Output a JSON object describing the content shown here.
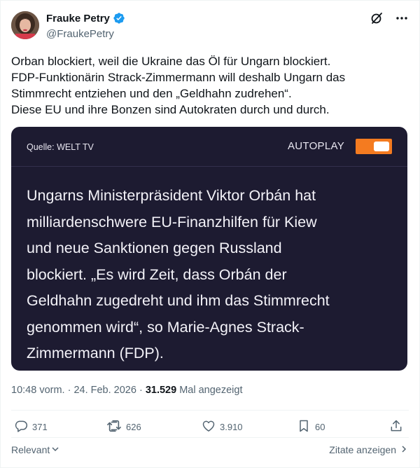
{
  "author": {
    "display_name": "Frauke Petry",
    "handle": "@FraukePetry",
    "verified": true
  },
  "tweet": {
    "lines": [
      "Orban blockiert, weil die Ukraine das Öl für Ungarn blockiert.",
      "FDP-Funktionärin Strack-Zimmermann will deshalb Ungarn das",
      "Stimmrecht entziehen und den „Geldhahn zudrehen“.",
      "Diese EU und ihre Bonzen sind Autokraten durch und durch."
    ]
  },
  "media": {
    "source": "Quelle: WELT TV",
    "autoplay_label": "AUTOPLAY",
    "autoplay_on": true,
    "quote_lines": [
      "Ungarns Ministerpräsident Viktor Orbán hat",
      "milliardenschwere EU-Finanzhilfen für Kiew",
      "und neue Sanktionen gegen Russland",
      "blockiert. „Es wird Zeit, dass Orbán der",
      "Geldhahn zugedreht und ihm das Stimmrecht",
      "genommen wird“, so Marie-Agnes Strack-",
      "Zimmermann (FDP)."
    ]
  },
  "meta": {
    "time_date": "10:48 vorm. · 24. Feb. 2026 · ",
    "views_count": "31.529",
    "views_label": " Mal angezeigt"
  },
  "actions": {
    "replies": "371",
    "reposts": "626",
    "likes": "3.910",
    "bookmarks": "60"
  },
  "footer": {
    "sort_label": "Relevant",
    "quotes_label": "Zitate anzeigen"
  },
  "colors": {
    "verified": "#1d9bf0",
    "media_bg": "#1d1b31",
    "toggle": "#f47b20",
    "secondary_text": "#536471"
  },
  "icons": [
    "verified-badge-icon",
    "grok-icon",
    "more-icon",
    "reply-icon",
    "repost-icon",
    "like-icon",
    "bookmark-icon",
    "share-icon",
    "chevron-down-icon",
    "chevron-right-icon"
  ]
}
